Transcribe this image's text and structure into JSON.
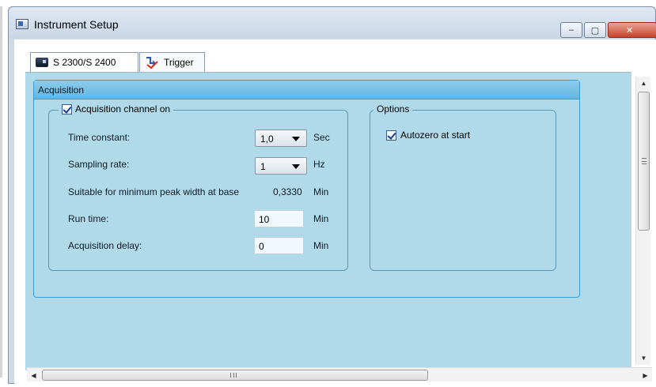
{
  "window": {
    "title": "Instrument Setup",
    "controls": {
      "minimize": "–",
      "maximize": "▢",
      "close": "✕"
    }
  },
  "tabs": [
    {
      "label": "S 2300/S 2400",
      "icon": "instrument-icon",
      "selected": true
    },
    {
      "label": "Trigger",
      "icon": "trigger-icon",
      "selected": false
    }
  ],
  "acquisition": {
    "header": "Acquisition",
    "channel_on": {
      "label": "Acquisition channel on",
      "checked": true
    },
    "time_constant": {
      "label": "Time constant:",
      "value": "1,0",
      "unit": "Sec"
    },
    "sampling_rate": {
      "label": "Sampling rate:",
      "value": "1",
      "unit": "Hz"
    },
    "min_peak_width": {
      "label": "Suitable for minimum peak width at base",
      "value": "0,3330",
      "unit": "Min"
    },
    "run_time": {
      "label": "Run time:",
      "value": "10",
      "unit": "Min"
    },
    "acquisition_delay": {
      "label": "Acquisition delay:",
      "value": "0",
      "unit": "Min"
    }
  },
  "options": {
    "title": "Options",
    "autozero": {
      "label": "Autozero at start",
      "checked": true
    }
  },
  "colors": {
    "panel_background": "#b0daea",
    "panel_header": "#63b6e2",
    "panel_border": "#3e9bd3",
    "close_button": "#c7442c"
  }
}
